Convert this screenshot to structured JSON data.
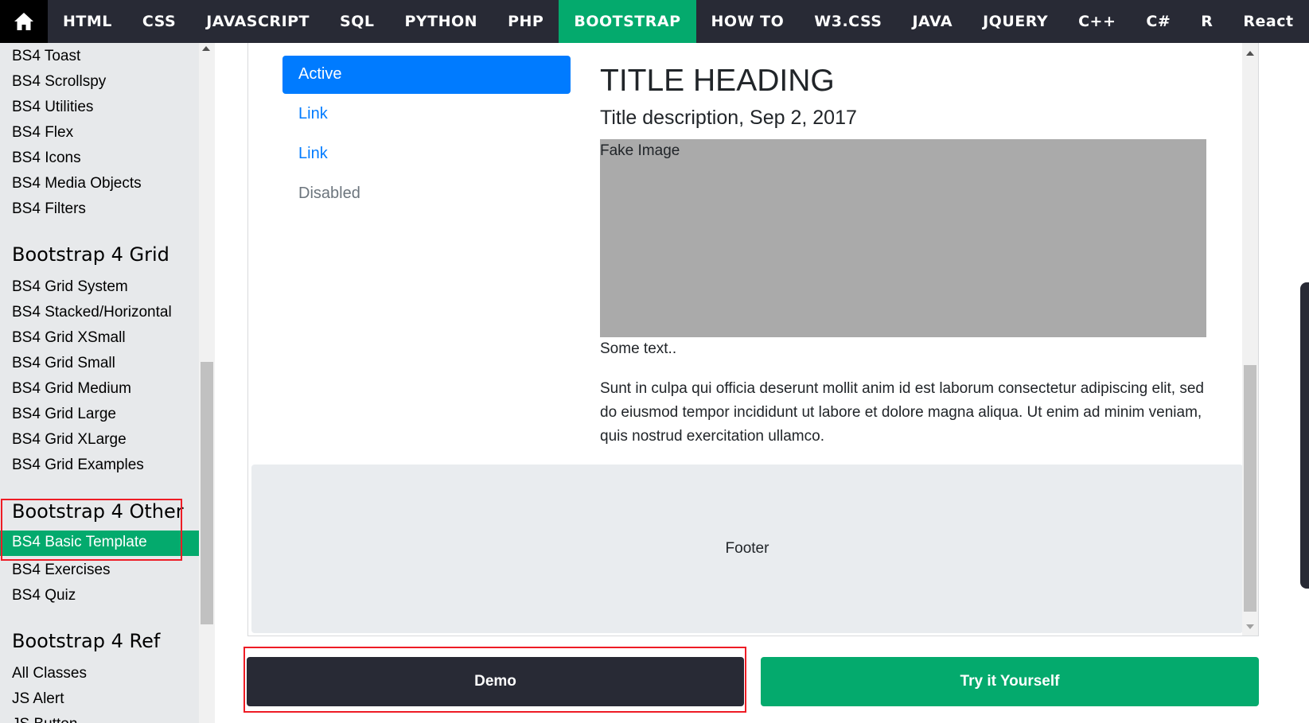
{
  "topnav": {
    "items": [
      "HTML",
      "CSS",
      "JAVASCRIPT",
      "SQL",
      "PYTHON",
      "PHP",
      "BOOTSTRAP",
      "HOW TO",
      "W3.CSS",
      "JAVA",
      "JQUERY",
      "C++",
      "C#",
      "R",
      "React"
    ],
    "active": "BOOTSTRAP"
  },
  "sidebar": {
    "links_top": [
      "BS4 Toast",
      "BS4 Scrollspy",
      "BS4 Utilities",
      "BS4 Flex",
      "BS4 Icons",
      "BS4 Media Objects",
      "BS4 Filters"
    ],
    "grid_heading": "Bootstrap 4 Grid",
    "grid_links": [
      "BS4 Grid System",
      "BS4 Stacked/Horizontal",
      "BS4 Grid XSmall",
      "BS4 Grid Small",
      "BS4 Grid Medium",
      "BS4 Grid Large",
      "BS4 Grid XLarge",
      "BS4 Grid Examples"
    ],
    "other_heading": "Bootstrap 4 Other",
    "other_active": "BS4 Basic Template",
    "other_links": [
      "BS4 Exercises",
      "BS4 Quiz"
    ],
    "ref_heading": "Bootstrap 4 Ref",
    "ref_links": [
      "All Classes",
      "JS Alert",
      "JS Button"
    ]
  },
  "demo": {
    "pills": [
      "Active",
      "Link",
      "Link",
      "Disabled"
    ],
    "title": "TITLE HEADING",
    "subtitle": "Title description, Sep 2, 2017",
    "fake_image": "Fake Image",
    "some_text": "Some text..",
    "paragraph": "Sunt in culpa qui officia deserunt mollit anim id est laborum consectetur adipiscing elit, sed do eiusmod tempor incididunt ut labore et dolore magna aliqua. Ut enim ad minim veniam, quis nostrud exercitation ullamco.",
    "footer": "Footer"
  },
  "buttons": {
    "demo": "Demo",
    "try": "Try it Yourself"
  },
  "colors": {
    "nav_bg": "#282a35",
    "accent_green": "#04aa6d",
    "bootstrap_blue": "#007bff",
    "highlight_red": "#ee1c25"
  }
}
